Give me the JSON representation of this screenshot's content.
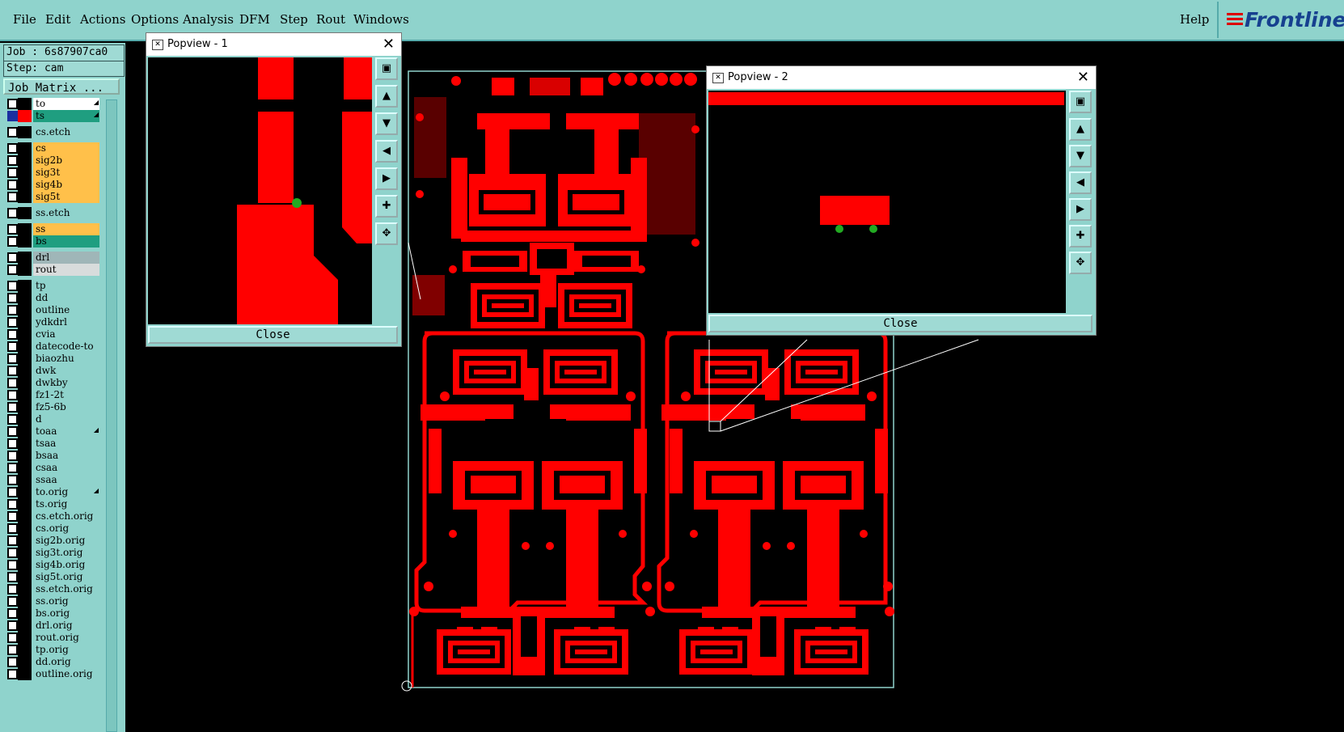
{
  "menu": {
    "file": "File",
    "edit": "Edit",
    "actions": "Actions",
    "options": "Options",
    "analysis": "Analysis",
    "dfm": "DFM",
    "step": "Step",
    "rout": "Rout",
    "windows": "Windows",
    "help": "Help"
  },
  "logo": {
    "text": "Frontline"
  },
  "job": {
    "job_line": "Job : 6s87907ca0",
    "step_line": "Step: cam",
    "matrix_button": "Job Matrix ..."
  },
  "layers": [
    {
      "name": "to",
      "color": "#ffffff",
      "marked": true
    },
    {
      "name": "ts",
      "color": "#1f9e80",
      "marked": true
    },
    {
      "name": "cs.etch",
      "color": "#8fd3cc",
      "marked": false
    },
    {
      "name": "cs",
      "color": "#ffc04a",
      "marked": false
    },
    {
      "name": "sig2b",
      "color": "#ffc04a",
      "marked": false
    },
    {
      "name": "sig3t",
      "color": "#ffc04a",
      "marked": false
    },
    {
      "name": "sig4b",
      "color": "#ffc04a",
      "marked": false
    },
    {
      "name": "sig5t",
      "color": "#ffc04a",
      "marked": false
    },
    {
      "name": "ss.etch",
      "color": "#8fd3cc",
      "marked": false
    },
    {
      "name": "ss",
      "color": "#ffc04a",
      "marked": false
    },
    {
      "name": "bs",
      "color": "#1f9e80",
      "marked": false
    },
    {
      "name": "drl",
      "color": "#9fb6b8",
      "marked": false
    },
    {
      "name": "rout",
      "color": "#d8dcdc",
      "marked": false
    },
    {
      "name": "tp",
      "color": "#8fd3cc",
      "marked": false
    },
    {
      "name": "dd",
      "color": "#8fd3cc",
      "marked": false
    },
    {
      "name": "outline",
      "color": "#8fd3cc",
      "marked": false
    },
    {
      "name": "ydkdrl",
      "color": "#8fd3cc",
      "marked": false
    },
    {
      "name": "cvia",
      "color": "#8fd3cc",
      "marked": false
    },
    {
      "name": "datecode-to",
      "color": "#8fd3cc",
      "marked": false
    },
    {
      "name": "biaozhu",
      "color": "#8fd3cc",
      "marked": false
    },
    {
      "name": "dwk",
      "color": "#8fd3cc",
      "marked": false
    },
    {
      "name": "dwkby",
      "color": "#8fd3cc",
      "marked": false
    },
    {
      "name": "fz1-2t",
      "color": "#8fd3cc",
      "marked": false
    },
    {
      "name": "fz5-6b",
      "color": "#8fd3cc",
      "marked": false
    },
    {
      "name": "d",
      "color": "#8fd3cc",
      "marked": false
    },
    {
      "name": "toaa",
      "color": "#8fd3cc",
      "marked": true
    },
    {
      "name": "tsaa",
      "color": "#8fd3cc",
      "marked": false
    },
    {
      "name": "bsaa",
      "color": "#8fd3cc",
      "marked": false
    },
    {
      "name": "csaa",
      "color": "#8fd3cc",
      "marked": false
    },
    {
      "name": "ssaa",
      "color": "#8fd3cc",
      "marked": false
    },
    {
      "name": "to.orig",
      "color": "#8fd3cc",
      "marked": true
    },
    {
      "name": "ts.orig",
      "color": "#8fd3cc",
      "marked": false
    },
    {
      "name": "cs.etch.orig",
      "color": "#8fd3cc",
      "marked": false
    },
    {
      "name": "cs.orig",
      "color": "#8fd3cc",
      "marked": false
    },
    {
      "name": "sig2b.orig",
      "color": "#8fd3cc",
      "marked": false
    },
    {
      "name": "sig3t.orig",
      "color": "#8fd3cc",
      "marked": false
    },
    {
      "name": "sig4b.orig",
      "color": "#8fd3cc",
      "marked": false
    },
    {
      "name": "sig5t.orig",
      "color": "#8fd3cc",
      "marked": false
    },
    {
      "name": "ss.etch.orig",
      "color": "#8fd3cc",
      "marked": false
    },
    {
      "name": "ss.orig",
      "color": "#8fd3cc",
      "marked": false
    },
    {
      "name": "bs.orig",
      "color": "#8fd3cc",
      "marked": false
    },
    {
      "name": "drl.orig",
      "color": "#8fd3cc",
      "marked": false
    },
    {
      "name": "rout.orig",
      "color": "#8fd3cc",
      "marked": false
    },
    {
      "name": "tp.orig",
      "color": "#8fd3cc",
      "marked": false
    },
    {
      "name": "dd.orig",
      "color": "#8fd3cc",
      "marked": false
    },
    {
      "name": "outline.orig",
      "color": "#8fd3cc",
      "marked": false
    }
  ],
  "popview1": {
    "title": "Popview - 1",
    "close_label": "Close"
  },
  "popview2": {
    "title": "Popview - 2",
    "close_label": "Close"
  },
  "colors": {
    "panel": "#8fd3cc",
    "copper": "#ff0000",
    "pad_marker": "#22aa22",
    "outline": "#9adfd8"
  }
}
